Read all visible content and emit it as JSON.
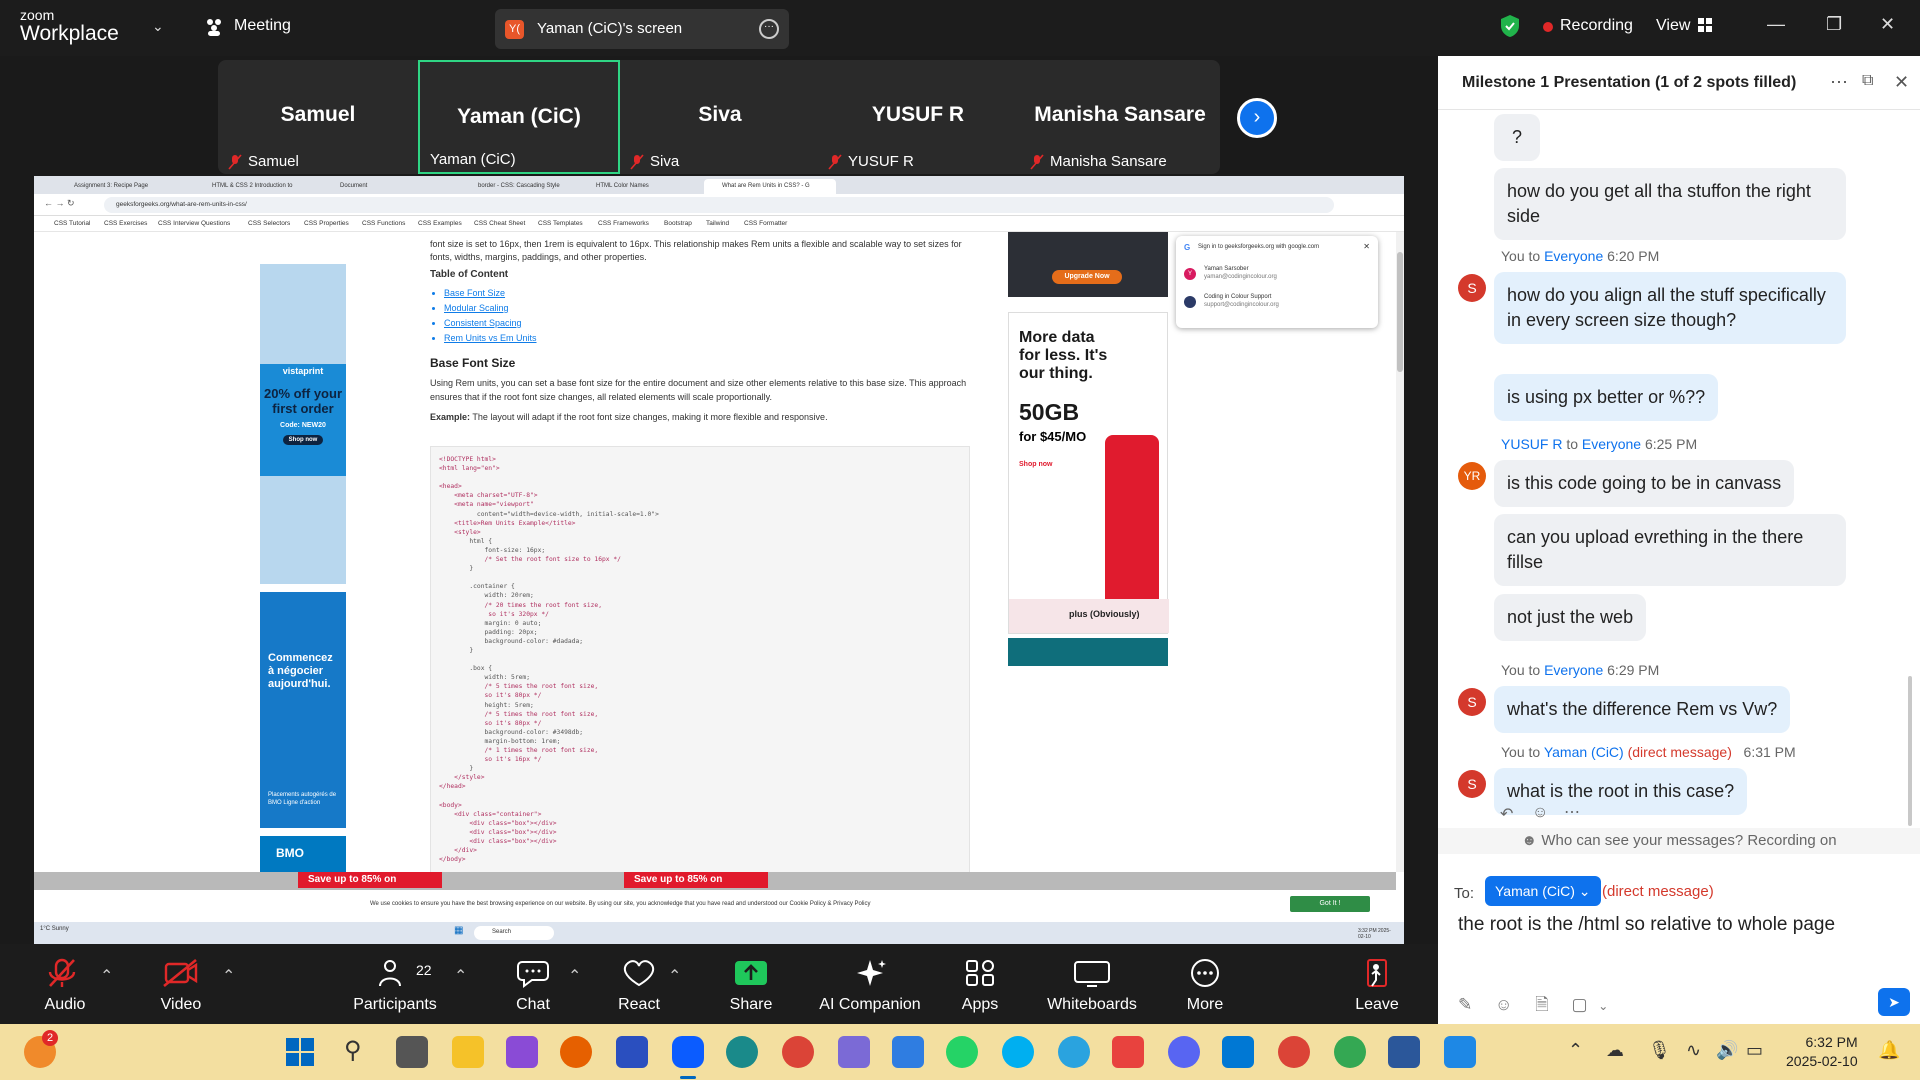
{
  "titlebar": {
    "logo_top": "zoom",
    "logo_bottom": "Workplace",
    "meeting_label": "Meeting",
    "share_badge": "Y(",
    "share_label": "Yaman (CiC)'s screen",
    "recording_label": "Recording",
    "view_label": "View"
  },
  "participants_tiles": [
    {
      "display": "Samuel",
      "label": "Samuel",
      "muted": true,
      "active": false
    },
    {
      "display": "Yaman (CiC)",
      "label": "Yaman (CiC)",
      "muted": false,
      "active": true
    },
    {
      "display": "Siva",
      "label": "Siva",
      "muted": true,
      "active": false
    },
    {
      "display": "YUSUF R",
      "label": "YUSUF R",
      "muted": true,
      "active": false
    },
    {
      "display": "Manisha Sansare",
      "label": "Manisha Sansare",
      "muted": true,
      "active": false
    }
  ],
  "shared_screen": {
    "tabs": [
      "Assignment 3: Recipe Page",
      "HTML & CSS 2 Introduction to",
      "Document",
      "border - CSS: Cascading Style",
      "HTML Color Names",
      "What are Rem Units in CSS? - G"
    ],
    "url": "geeksforgeeks.org/what-are-rem-units-in-css/",
    "nav_items": [
      "CSS Tutorial",
      "CSS Exercises",
      "CSS Interview Questions",
      "CSS Selectors",
      "CSS Properties",
      "CSS Functions",
      "CSS Examples",
      "CSS Cheat Sheet",
      "CSS Templates",
      "CSS Frameworks",
      "Bootstrap",
      "Tailwind",
      "CSS Formatter"
    ],
    "intro_text": "font size is set to 16px, then 1rem is equivalent to 16px. This relationship makes Rem units a flexible and scalable way to set sizes for fonts, widths, margins, paddings, and other properties.",
    "toc_title": "Table of Content",
    "toc_items": [
      "Base Font Size",
      "Modular Scaling",
      "Consistent Spacing",
      "Rem Units vs Em Units"
    ],
    "section_title": "Base Font Size",
    "section_text": "Using Rem units, you can set a base font size for the entire document and size other elements relative to this base size. This approach ensures that if the root font size changes, all related elements will scale proportionally.",
    "example_label": "Example:",
    "example_text": "The layout will adapt if the root font size changes, making it more flexible and responsive.",
    "code_lines": [
      "<!DOCTYPE html>",
      "<html lang=\"en\">",
      "",
      "<head>",
      "    <meta charset=\"UTF-8\">",
      "    <meta name=\"viewport\"",
      "          content=\"width=device-width, initial-scale=1.0\">",
      "    <title>Rem Units Example</title>",
      "    <style>",
      "        html {",
      "            font-size: 16px;",
      "            /* Set the root font size to 16px */",
      "        }",
      "",
      "        .container {",
      "            width: 20rem;",
      "            /* 20 times the root font size,",
      "             so it's 320px */",
      "            margin: 0 auto;",
      "            padding: 20px;",
      "            background-color: #dadada;",
      "        }",
      "",
      "        .box {",
      "            width: 5rem;",
      "            /* 5 times the root font size,",
      "            so it's 80px */",
      "            height: 5rem;",
      "            /* 5 times the root font size,",
      "            so it's 80px */",
      "            background-color: #3498db;",
      "            margin-bottom: 1rem;",
      "            /* 1 times the root font size,",
      "            so it's 16px */",
      "        }",
      "    </style>",
      "</head>",
      "",
      "<body>",
      "    <div class=\"container\">",
      "        <div class=\"box\"></div>",
      "        <div class=\"box\"></div>",
      "        <div class=\"box\"></div>",
      "    </div>",
      "</body>"
    ],
    "ad_vistaprint": {
      "brand": "vistaprint",
      "offer": "20% off your first order",
      "code": "Code: NEW20",
      "cta": "Shop now"
    },
    "ad_bmo": {
      "text": "Commencez à négocier aujourd'hui.",
      "footer": "Placements autogérés de BMO Ligne d'action",
      "brand": "BMO"
    },
    "ad_upgrade": "Upgrade Now",
    "ad_virgin": {
      "headline": "More data for less. It's our thing.",
      "gb": "50GB",
      "price": "for $45/MO",
      "cta": "Shop now",
      "footer": "plus (Obviously)"
    },
    "google_signin": {
      "title": "Sign in to geeksforgeeks.org with google.com",
      "acct1_name": "Yaman Sarsober",
      "acct1_email": "yaman@codingincolour.org",
      "acct2_name": "Coding in Colour Support",
      "acct2_email": "support@codingincolour.org"
    },
    "save_ad": "Save up to 85% on",
    "cookie_text": "We use cookies to ensure you have the best browsing experience on our website. By using our site, you acknowledge that you have read and understood our Cookie Policy & Privacy Policy",
    "cookie_btn": "Got It !",
    "weather": "1°C Sunny",
    "win_search": "Search",
    "win_time": "3:32 PM 2025-02-10"
  },
  "toolbar": {
    "audio": "Audio",
    "video": "Video",
    "participants": "Participants",
    "participants_count": "22",
    "chat": "Chat",
    "react": "React",
    "share": "Share",
    "ai_companion": "AI Companion",
    "apps": "Apps",
    "whiteboards": "Whiteboards",
    "more": "More",
    "leave": "Leave"
  },
  "chat": {
    "title": "Milestone 1 Presentation (1 of 2 spots filled)",
    "messages": [
      {
        "text": "?"
      },
      {
        "text": "how do you get all tha stuffon the right side"
      },
      {
        "sender": "You",
        "to": "Everyone",
        "time": "6:20 PM",
        "avatar": "S",
        "text": "how do you align all the stuff specifically in every screen size though?"
      },
      {
        "text": "is using px better or %??"
      },
      {
        "sender": "YUSUF R",
        "to": "Everyone",
        "time": "6:25 PM",
        "avatar": "YR",
        "text": "is this code going to be in canvass"
      },
      {
        "text": "can you upload evrething in the there fillse"
      },
      {
        "text": "not just the web"
      },
      {
        "sender": "You",
        "to": "Everyone",
        "time": "6:29 PM",
        "avatar": "S",
        "text": "what's the difference Rem vs Vw?"
      },
      {
        "sender": "You",
        "to": "Yaman (CiC)",
        "dm": "(direct message)",
        "time": "6:31 PM",
        "avatar": "S",
        "text": "what is the root in this case?"
      }
    ],
    "to_word": "to",
    "visibility_note": "Who can see your messages? Recording on",
    "to_label": "To:",
    "to_recipient": "Yaman (CiC)",
    "dm_label": "(direct message)",
    "draft": "the root is the /html so relative to whole page"
  },
  "taskbar": {
    "notification_count": "2",
    "time": "6:32 PM",
    "date": "2025-02-10"
  }
}
